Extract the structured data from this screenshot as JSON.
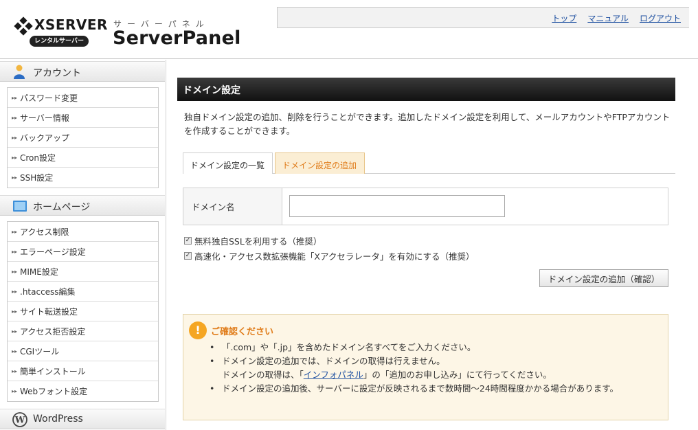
{
  "header": {
    "brand": "XSERVER",
    "brand_sub": "レンタルサーバー",
    "kana": "サーバーパネル",
    "title": "ServerPanel",
    "links": [
      "トップ",
      "マニュアル",
      "ログアウト"
    ]
  },
  "sidebar": {
    "sections": [
      {
        "label": "アカウント",
        "icon": "person-icon",
        "items": [
          "パスワード変更",
          "サーバー情報",
          "バックアップ",
          "Cron設定",
          "SSH設定"
        ]
      },
      {
        "label": "ホームページ",
        "icon": "monitor-icon",
        "items": [
          "アクセス制限",
          "エラーページ設定",
          "MIME設定",
          ".htaccess編集",
          "サイト転送設定",
          "アクセス拒否設定",
          "CGIツール",
          "簡単インストール",
          "Webフォント設定"
        ]
      },
      {
        "label": "WordPress",
        "icon": "wordpress-icon",
        "items": []
      }
    ]
  },
  "main": {
    "title": "ドメイン設定",
    "description": "独自ドメイン設定の追加、削除を行うことができます。追加したドメイン設定を利用して、メールアカウントやFTPアカウントを作成することができます。",
    "tabs": [
      {
        "label": "ドメイン設定の一覧",
        "active": false
      },
      {
        "label": "ドメイン設定の追加",
        "active": true
      }
    ],
    "form": {
      "label": "ドメイン名",
      "value": "",
      "placeholder": ""
    },
    "checkboxes": [
      {
        "label": "無料独自SSLを利用する（推奨）",
        "checked": true
      },
      {
        "label": "高速化・アクセス数拡張機能「Xアクセラレータ」を有効にする（推奨）",
        "checked": true
      }
    ],
    "confirm_button": "ドメイン設定の追加（確認）",
    "notice": {
      "title": "ご確認ください",
      "items": [
        "「.com」や「.jp」を含めたドメイン名すべてをご入力ください。",
        "ドメイン設定の追加では、ドメインの取得は行えません。",
        "ドメイン設定の追加後、サーバーに設定が反映されるまで数時間〜24時間程度かかる場合があります。"
      ],
      "item2_line2_pre": "ドメインの取得は、「",
      "item2_link": "インフォパネル",
      "item2_line2_post": "」の「追加のお申し込み」にて行ってください。"
    }
  },
  "colors": {
    "accent_orange": "#e07c1a",
    "link_blue": "#1d4fa0",
    "title_bar": "#1a1a1a"
  }
}
